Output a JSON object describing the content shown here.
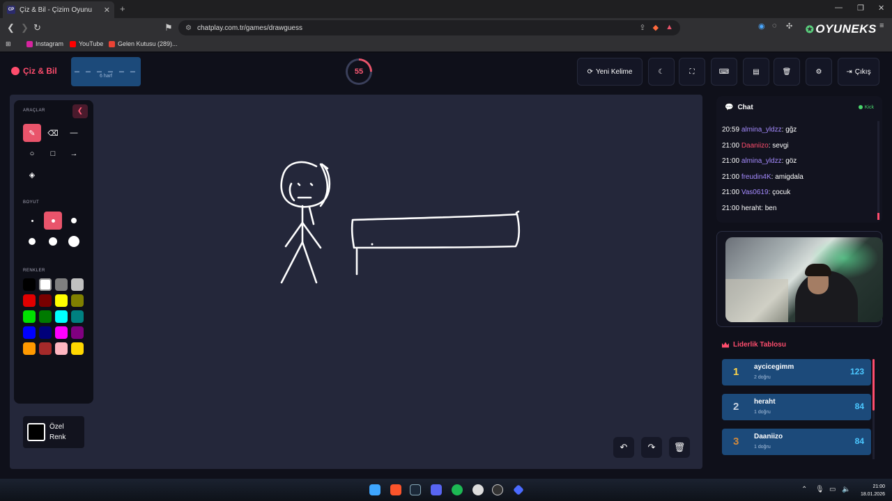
{
  "browser": {
    "tab_title": "Çiz & Bil - Çizim Oyunu",
    "tab_favicon": "CP",
    "url": "chatplay.com.tr/games/drawguess",
    "bookmarks": [
      "Instagram",
      "YouTube",
      "Gelen Kutusu (289)..."
    ],
    "overlay_logo": "OYUNEKS"
  },
  "header": {
    "app_name": "Çiz & Bil",
    "word_blanks": "_ _ _ _ _ _",
    "word_hint": "6 harf",
    "timer": "55",
    "timer_progress": 0.25,
    "new_word_label": "Yeni Kelime",
    "exit_label": "Çıkış"
  },
  "tools": {
    "tools_title": "ARAÇLAR",
    "size_title": "BOYUT",
    "colors_title": "RENKLER",
    "custom_color_label": "Özel Renk",
    "tool_icons": [
      "brush-icon",
      "eraser-icon",
      "line-icon",
      "circle-icon",
      "square-icon",
      "arrow-icon",
      "fill-icon"
    ],
    "active_tool": "brush-icon",
    "selected_size_index": 1,
    "colors": [
      "#000000",
      "#ffffff",
      "#808080",
      "#c0c0c0",
      "#e00000",
      "#7a0000",
      "#ffff00",
      "#808000",
      "#00e000",
      "#007a00",
      "#00ffff",
      "#008080",
      "#0000ff",
      "#00007a",
      "#ff00ff",
      "#800080",
      "#ff9900",
      "#a52a2a",
      "#ffb6c1",
      "#ffd700"
    ],
    "selected_color": "#ffffff"
  },
  "chat": {
    "title": "Chat",
    "status": "Kick",
    "messages": [
      {
        "time": "20:59",
        "user": "almina_yldzz",
        "text": "gğz"
      },
      {
        "time": "21:00",
        "user": "Daaniizo",
        "text": "sevgi"
      },
      {
        "time": "21:00",
        "user": "almina_yldzz",
        "text": "göz"
      },
      {
        "time": "21:00",
        "user": "freudin4K",
        "text": "amigdala"
      },
      {
        "time": "21:00",
        "user": "Vas0619",
        "text": "çocuk"
      },
      {
        "time": "21:00",
        "user": "heraht",
        "text": "ben"
      }
    ]
  },
  "leaderboard": {
    "title": "Liderlik Tablosu",
    "rows": [
      {
        "rank": "1",
        "name": "aycicegimm",
        "sub": "2 doğru",
        "score": "123",
        "rank_color": "#ffd54a"
      },
      {
        "rank": "2",
        "name": "heraht",
        "sub": "1 doğru",
        "score": "84",
        "rank_color": "#c9d3e0"
      },
      {
        "rank": "3",
        "name": "Daaniizo",
        "sub": "1 doğru",
        "score": "84",
        "rank_color": "#d28a3c"
      }
    ]
  },
  "taskbar": {
    "time": "21:00",
    "date": "18.01.2026"
  },
  "colors": {
    "accent": "#e9546b",
    "word_box": "#1c4a7a",
    "canvas": "#24273a"
  }
}
